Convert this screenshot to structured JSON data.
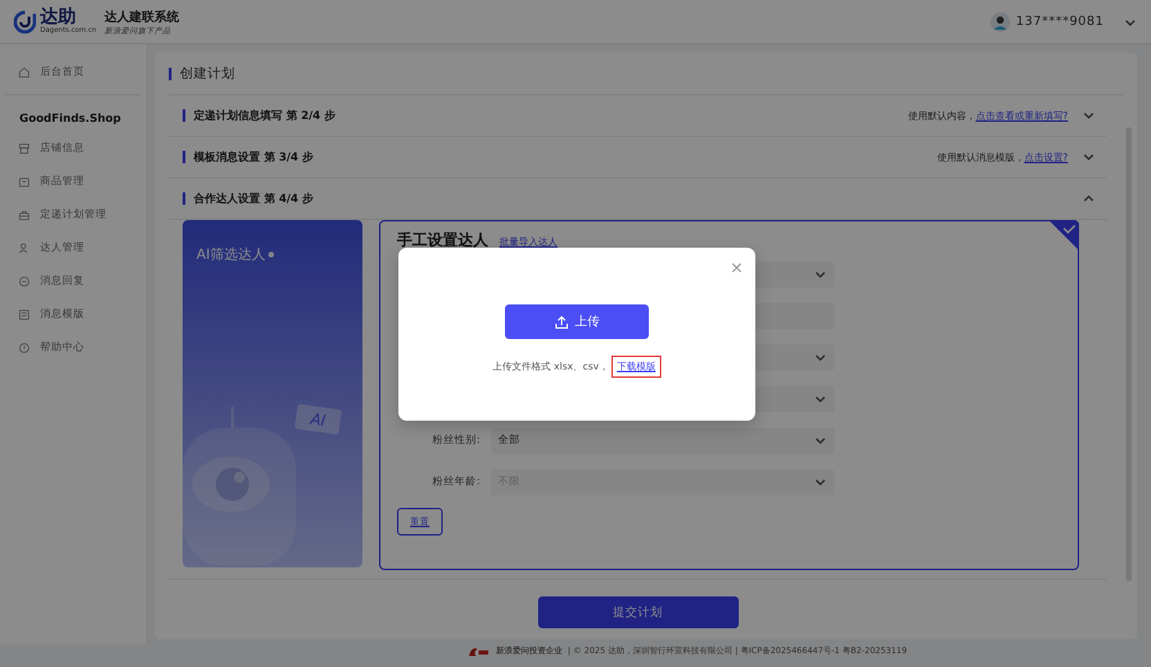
{
  "header": {
    "logo_text": "达助",
    "logo_domain": "Dagents.com.cn",
    "system_name": "达人建联系统",
    "tagline": "新浪爱问旗下产品",
    "user": "137****9081"
  },
  "sidebar": {
    "home": "后台首页",
    "shop": "GoodFinds.Shop",
    "items": [
      {
        "label": "店铺信息"
      },
      {
        "label": "商品管理"
      },
      {
        "label": "定递计划管理"
      },
      {
        "label": "达人管理"
      },
      {
        "label": "消息回复"
      },
      {
        "label": "消息模版"
      },
      {
        "label": "帮助中心"
      }
    ]
  },
  "page_title": "创建计划",
  "steps": [
    {
      "title": "定递计划信息填写 第 2/4 步",
      "note": "使用默认内容，",
      "link": "点击查看或重新填写?",
      "expanded": false
    },
    {
      "title": "模板消息设置 第 3/4 步",
      "note": "使用默认消息模版，",
      "link": "点击设置?",
      "expanded": false
    },
    {
      "title": "合作达人设置 第 4/4 步",
      "expanded": true
    }
  ],
  "ai_card": {
    "title": "AI筛选达人",
    "badge": "AI"
  },
  "manual": {
    "title": "手工设置达人",
    "link": "批量导入达人",
    "selected": true,
    "reset": "重置",
    "fields": [
      {
        "kind": "select"
      },
      {
        "kind": "input"
      },
      {
        "kind": "select"
      },
      {
        "kind": "select"
      },
      {
        "kind": "select",
        "label": "粉丝性别:",
        "value": "全部"
      },
      {
        "kind": "select",
        "label": "粉丝年龄:",
        "placeholder": "不限"
      }
    ]
  },
  "submit": "提交计划",
  "footer": {
    "partner": "新浪爱问投资企业",
    "copyright": "| © 2025 达助，深圳智行环宣科技有限公司 | 粤ICP备2025466447号-1 粤B2-20253119"
  },
  "modal": {
    "upload": "上传",
    "hint": "上传文件格式 xlsx、csv，",
    "link": "下载模版",
    "link_highlighted": true
  }
}
